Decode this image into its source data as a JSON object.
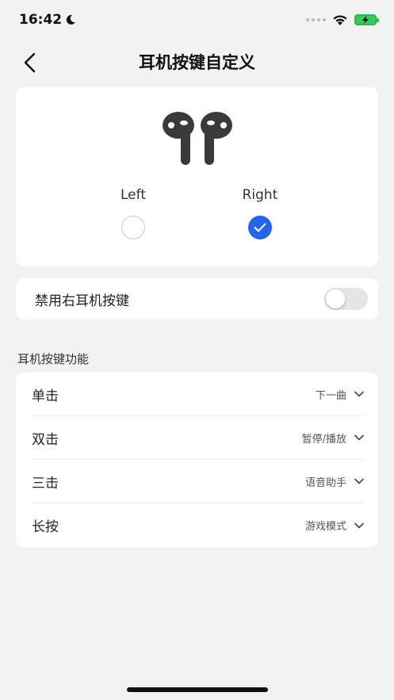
{
  "status_bar": {
    "time": "16:42",
    "icons": [
      "moon-icon",
      "signal-dots-icon",
      "wifi-icon",
      "battery-charging-icon"
    ],
    "battery_color": "#38c95a"
  },
  "nav": {
    "title": "耳机按键自定义",
    "back_icon": "chevron-left-icon"
  },
  "earphone_select": {
    "left_label": "Left",
    "right_label": "Right",
    "selected": "right",
    "accent_color": "#2563eb"
  },
  "disable_right": {
    "label": "禁用右耳机按键",
    "enabled": false
  },
  "functions": {
    "header": "耳机按键功能",
    "rows": [
      {
        "name": "单击",
        "value": "下一曲"
      },
      {
        "name": "双击",
        "value": "暂停/播放"
      },
      {
        "name": "三击",
        "value": "语音助手"
      },
      {
        "name": "长按",
        "value": "游戏模式"
      }
    ]
  }
}
